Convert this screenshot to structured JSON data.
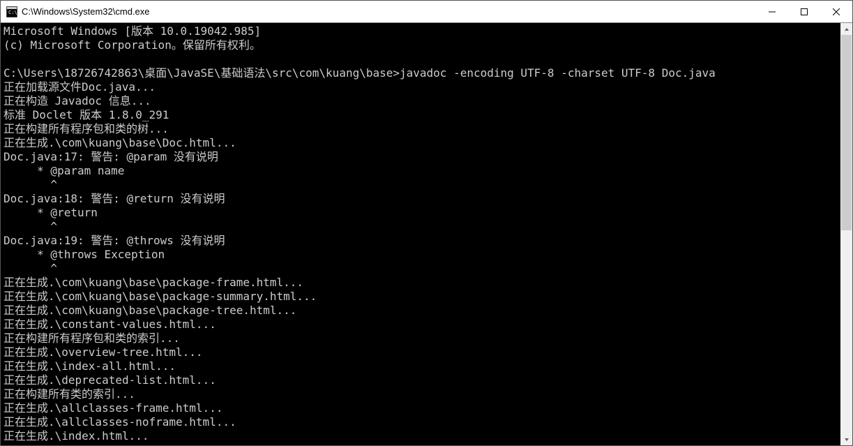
{
  "window": {
    "title": "C:\\Windows\\System32\\cmd.exe"
  },
  "terminal": {
    "lines": [
      "Microsoft Windows [版本 10.0.19042.985]",
      "(c) Microsoft Corporation。保留所有权利。",
      "",
      "C:\\Users\\18726742863\\桌面\\JavaSE\\基础语法\\src\\com\\kuang\\base>javadoc -encoding UTF-8 -charset UTF-8 Doc.java",
      "正在加载源文件Doc.java...",
      "正在构造 Javadoc 信息...",
      "标准 Doclet 版本 1.8.0_291",
      "正在构建所有程序包和类的树...",
      "正在生成.\\com\\kuang\\base\\Doc.html...",
      "Doc.java:17: 警告: @param 没有说明",
      "     * @param name",
      "       ^",
      "Doc.java:18: 警告: @return 没有说明",
      "     * @return",
      "       ^",
      "Doc.java:19: 警告: @throws 没有说明",
      "     * @throws Exception",
      "       ^",
      "正在生成.\\com\\kuang\\base\\package-frame.html...",
      "正在生成.\\com\\kuang\\base\\package-summary.html...",
      "正在生成.\\com\\kuang\\base\\package-tree.html...",
      "正在生成.\\constant-values.html...",
      "正在构建所有程序包和类的索引...",
      "正在生成.\\overview-tree.html...",
      "正在生成.\\index-all.html...",
      "正在生成.\\deprecated-list.html...",
      "正在构建所有类的索引...",
      "正在生成.\\allclasses-frame.html...",
      "正在生成.\\allclasses-noframe.html...",
      "正在生成.\\index.html..."
    ]
  }
}
